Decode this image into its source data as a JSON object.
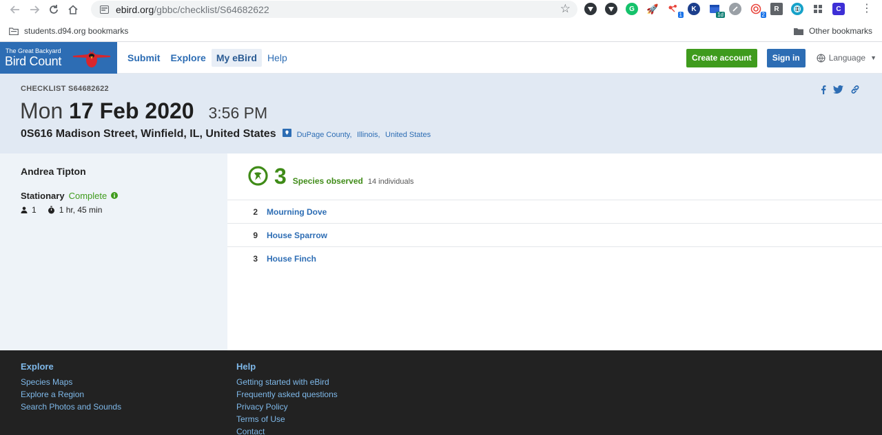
{
  "browser": {
    "url_host": "ebird.org",
    "url_path": "/gbbc/checklist/S64682622",
    "bookmarks": {
      "left": "students.d94.org bookmarks",
      "right": "Other bookmarks"
    },
    "extension_badges": {
      "ext5": "1",
      "ext7": "1d",
      "ext9": "2"
    },
    "extension_letters": {
      "ext6": "K",
      "ext10": "R",
      "ext13": "C"
    }
  },
  "site": {
    "logo": {
      "line1": "The Great Backyard",
      "line2": "Bird Count"
    },
    "nav": {
      "submit": "Submit",
      "explore": "Explore",
      "my_ebird": "My eBird",
      "help": "Help"
    },
    "header_actions": {
      "create_account": "Create account",
      "sign_in": "Sign in",
      "language": "Language"
    }
  },
  "checklist": {
    "id_label": "CHECKLIST S64682622",
    "day": "Mon",
    "date": "17 Feb 2020",
    "time": "3:56 PM",
    "address": "0S616 Madison Street, Winfield, IL, United States",
    "region": {
      "county": "DuPage County,",
      "state": "Illinois,",
      "country": "United States"
    }
  },
  "sidebar": {
    "observer": "Andrea Tipton",
    "protocol": "Stationary",
    "status": "Complete",
    "observers_count": "1",
    "duration": "1 hr, 45 min"
  },
  "summary": {
    "species_count": "3",
    "species_label": "Species observed",
    "individuals": "14 individuals"
  },
  "species": [
    {
      "count": "2",
      "name": "Mourning Dove"
    },
    {
      "count": "9",
      "name": "House Sparrow"
    },
    {
      "count": "3",
      "name": "House Finch"
    }
  ],
  "footer": {
    "explore": {
      "heading": "Explore",
      "links": [
        "Species Maps",
        "Explore a Region",
        "Search Photos and Sounds"
      ]
    },
    "help": {
      "heading": "Help",
      "links": [
        "Getting started with eBird",
        "Frequently asked questions",
        "Privacy Policy",
        "Terms of Use",
        "Contact"
      ]
    }
  },
  "colors": {
    "brand_blue": "#2d6db4",
    "green": "#3f9b1d",
    "hero_bg": "#e1e9f3",
    "footer_bg": "#222222",
    "footer_link": "#7fb9ea"
  }
}
